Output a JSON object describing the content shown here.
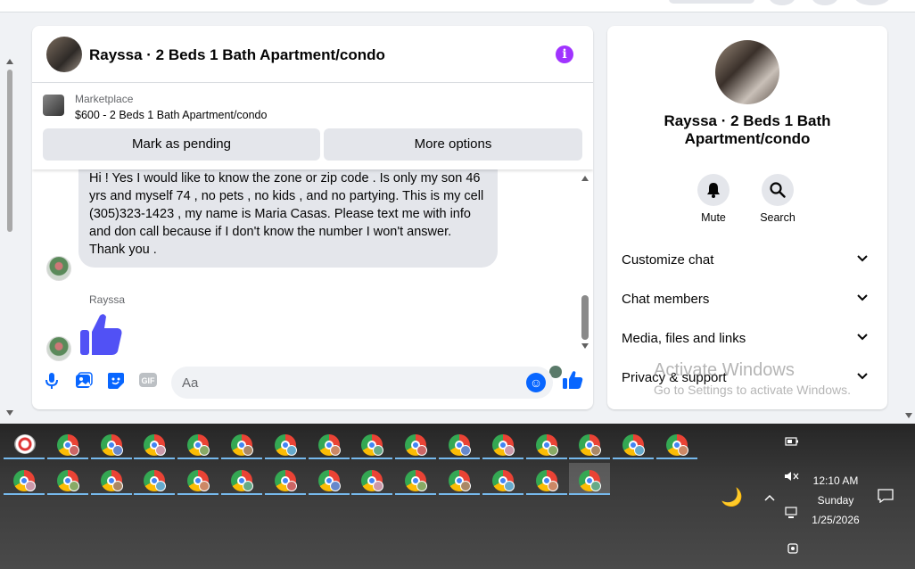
{
  "chat": {
    "title": "Rayssa · 2 Beds 1 Bath Apartment/condo",
    "info_icon": "i",
    "marketplace": {
      "label": "Marketplace",
      "listing": "$600 - 2 Beds 1 Bath Apartment/condo",
      "mark_pending": "Mark as pending",
      "more_options": "More options"
    },
    "message_text": "Hi ! Yes I would like to know the zone or zip code . Is only my son 46 yrs and myself 74 , no pets , no kids , and no partying.  This is my cell (305)323-1423 , my name is Maria Casas.  Please text me with info and don call because if I don't know the number I won't answer.  Thank you .",
    "sender_name": "Rayssa",
    "composer_placeholder": "Aa"
  },
  "details": {
    "title": "Rayssa · 2 Beds 1 Bath Apartment/condo",
    "mute_label": "Mute",
    "search_label": "Search",
    "rows": [
      "Customize chat",
      "Chat members",
      "Media, files and links",
      "Privacy & support"
    ]
  },
  "watermark": {
    "line1": "Activate Windows",
    "line2": "Go to Settings to activate Windows."
  },
  "taskbar": {
    "time": "12:10 AM",
    "day": "Sunday",
    "date": "1/25/2026"
  },
  "colors": {
    "accent": "#0866ff",
    "info": "#a033ff",
    "like": "#5151f5"
  }
}
